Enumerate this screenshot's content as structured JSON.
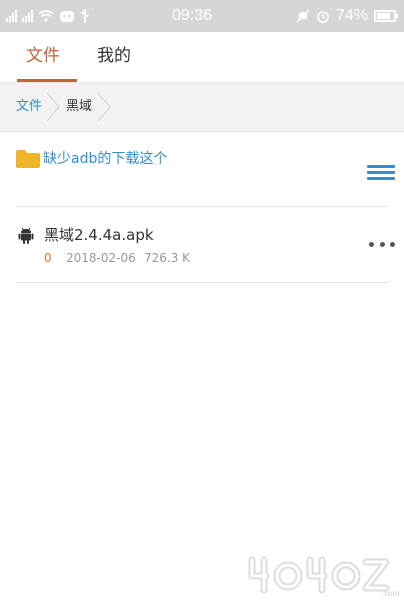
{
  "status_bar": {
    "time": "09:36",
    "battery": "74%",
    "network_labels": [
      "ıl",
      "ıl"
    ],
    "icons": [
      "signal-icon",
      "wifi-icon",
      "notification-icon",
      "usb-icon",
      "mute-icon",
      "alarm-icon",
      "battery-icon"
    ]
  },
  "tabs": [
    {
      "label": "文件",
      "active": true
    },
    {
      "label": "我的",
      "active": false
    }
  ],
  "breadcrumb": [
    "文件",
    "黑域"
  ],
  "folder": {
    "title": "缺少adb的下载这个"
  },
  "files": [
    {
      "name": "黑域2.4.4a.apk",
      "count": "0",
      "date": "2018-02-06",
      "size": "726.3 K"
    }
  ],
  "watermark_text": "4O4OZ.com",
  "colors": {
    "accent": "#c2643a",
    "link": "#2f8fd0",
    "folder": "#f0b428",
    "count": "#e07a2a"
  }
}
